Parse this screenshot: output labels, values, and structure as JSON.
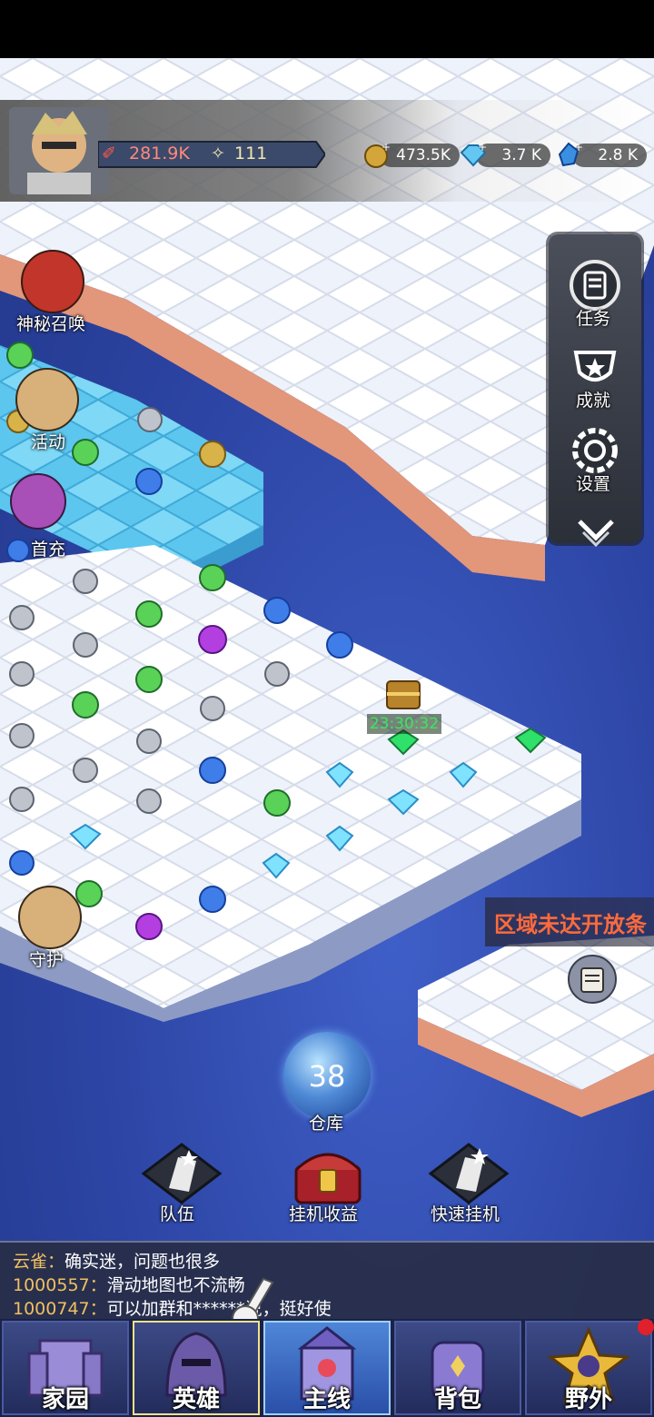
{
  "header": {
    "power": "281.9K",
    "stars": "111",
    "resources": [
      {
        "name": "gold-coin",
        "value": "473.5K"
      },
      {
        "name": "blue-diamond",
        "value": "3.7 K"
      },
      {
        "name": "blue-crystal",
        "value": "2.8 K"
      }
    ]
  },
  "left_menu": [
    {
      "label": "神秘召唤",
      "icon": "mystery-summon-icon"
    },
    {
      "label": "活动",
      "icon": "event-icon"
    },
    {
      "label": "首充",
      "icon": "first-recharge-icon"
    },
    {
      "label": "守护",
      "icon": "guardian-icon"
    }
  ],
  "right_menu": [
    {
      "label": "任务",
      "icon": "task-icon"
    },
    {
      "label": "成就",
      "icon": "trophy-icon"
    },
    {
      "label": "设置",
      "icon": "gear-icon"
    }
  ],
  "map": {
    "chest_timer": "23:30:32",
    "region_notice": "区域未达开放条",
    "warehouse_count": "38",
    "warehouse_label": "仓库"
  },
  "actions": [
    {
      "label": "队伍",
      "icon": "team-icon"
    },
    {
      "label": "挂机收益",
      "icon": "idle-reward-chest-icon"
    },
    {
      "label": "快速挂机",
      "icon": "quick-idle-icon"
    }
  ],
  "chat": [
    {
      "who": "云雀",
      "sep": "：",
      "text": "确实迷，问题也很多"
    },
    {
      "who": "1000557",
      "sep": "：",
      "text": "滑动地图也不流畅"
    },
    {
      "who": "1000747",
      "sep": "：",
      "text": "可以加群和******说，挺好使"
    }
  ],
  "nav": [
    {
      "label": "家园",
      "icon": "castle-icon"
    },
    {
      "label": "英雄",
      "icon": "knight-helmet-icon"
    },
    {
      "label": "主线",
      "icon": "main-castle-icon"
    },
    {
      "label": "背包",
      "icon": "backpack-icon"
    },
    {
      "label": "野外",
      "icon": "wild-star-icon"
    }
  ],
  "colors": {
    "sea": "#2c44a3",
    "snow": "#f4f6fb",
    "ice": "#5ec8ef",
    "cliff": "#e2967a",
    "accent": "#39e85c"
  }
}
